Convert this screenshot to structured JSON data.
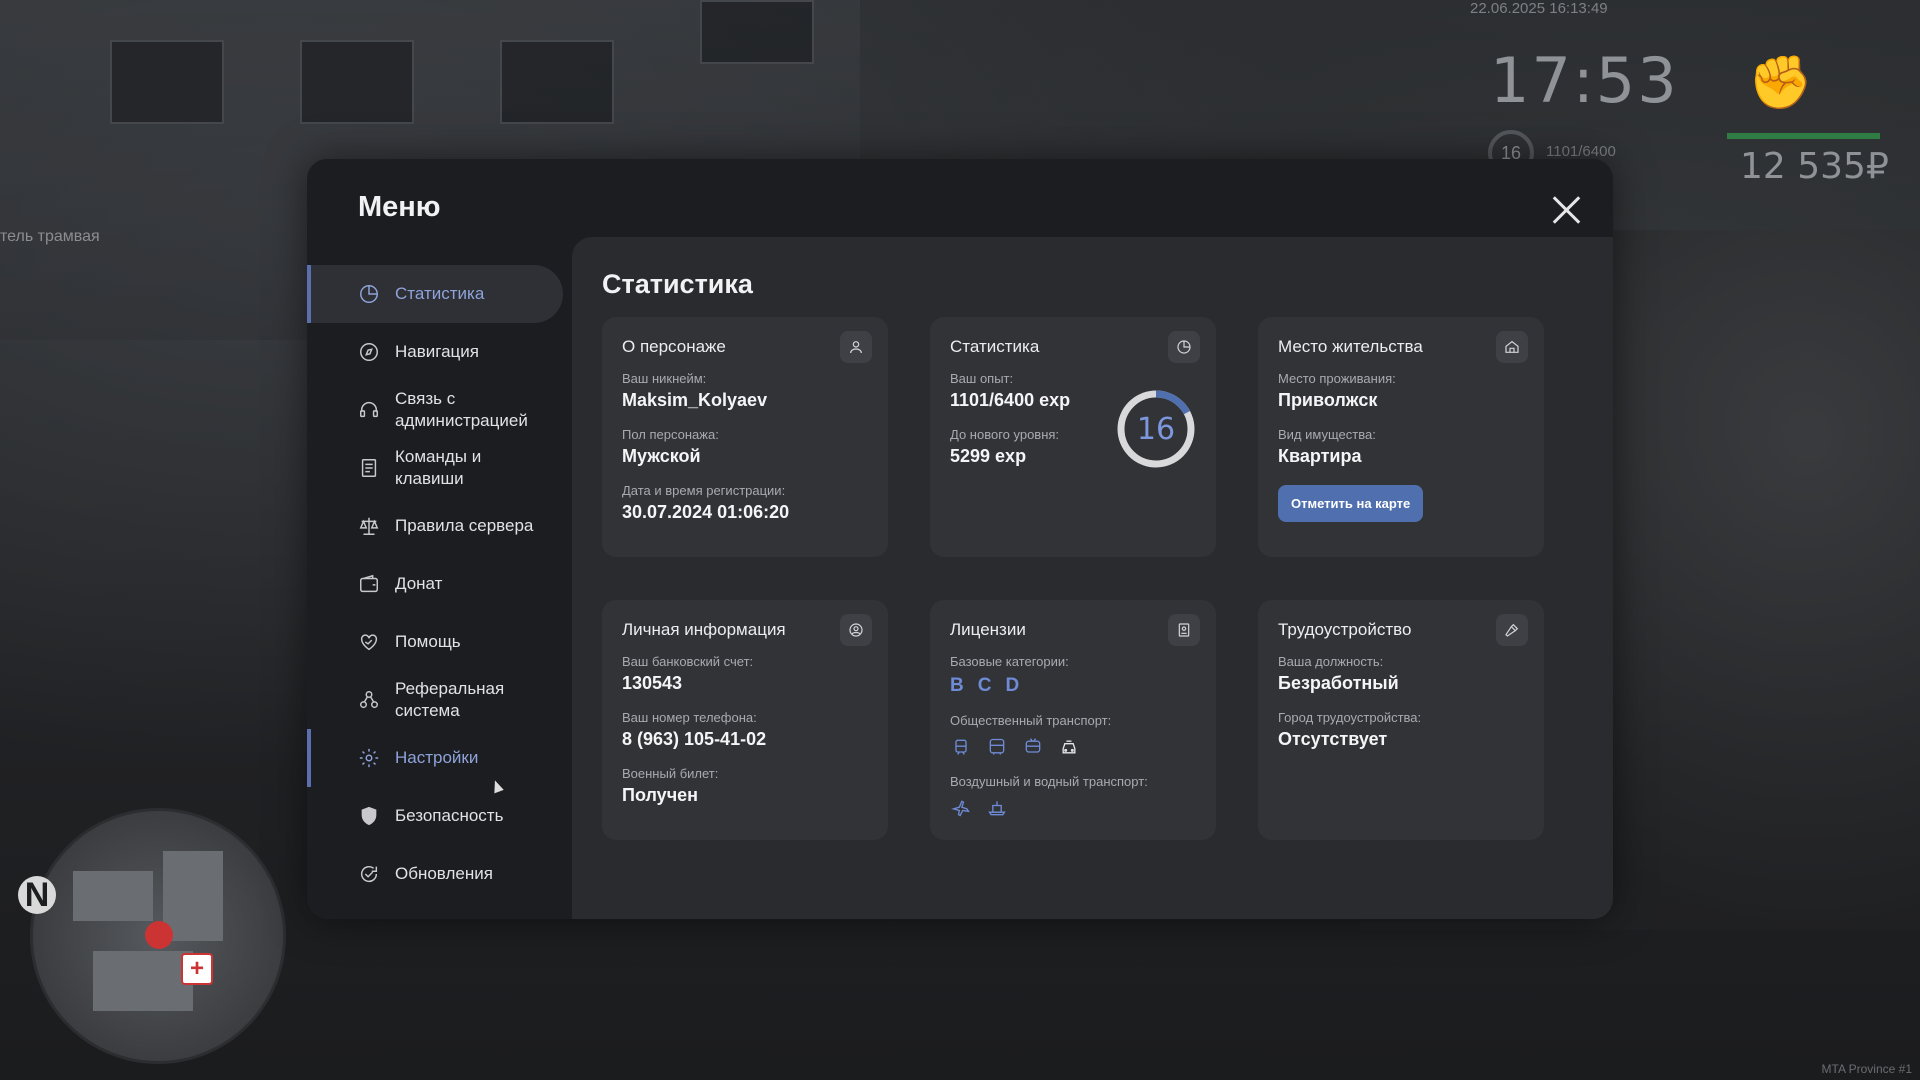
{
  "game": {
    "street_text": "тель трамвая",
    "datetime": "22.06.2025 16:13:49",
    "clock": "17:53",
    "level": "16",
    "exp": "1101/6400",
    "money": "12 535₽",
    "compass": "N",
    "watermark": "MTA Province #1"
  },
  "menu": {
    "title": "Меню",
    "close_icon": "close-icon"
  },
  "sidebar": {
    "items": [
      {
        "label": "Статистика",
        "icon": "pie-chart-icon"
      },
      {
        "label": "Навигация",
        "icon": "compass-icon"
      },
      {
        "label": "Связь с администрацией",
        "icon": "headset-icon"
      },
      {
        "label": "Команды и клавиши",
        "icon": "document-icon"
      },
      {
        "label": "Правила сервера",
        "icon": "scales-icon"
      },
      {
        "label": "Донат",
        "icon": "wallet-icon"
      },
      {
        "label": "Помощь",
        "icon": "heart-handshake-icon"
      },
      {
        "label": "Реферальная система",
        "icon": "referral-icon"
      },
      {
        "label": "Настройки",
        "icon": "gear-icon"
      },
      {
        "label": "Безопасность",
        "icon": "shield-icon"
      },
      {
        "label": "Обновления",
        "icon": "refresh-check-icon"
      }
    ]
  },
  "content": {
    "title": "Статистика",
    "character": {
      "title": "О персонаже",
      "nickname_label": "Ваш никнейм:",
      "nickname": "Maksim_Kolyaev",
      "gender_label": "Пол персонажа:",
      "gender": "Мужской",
      "reg_label": "Дата и время регистрации:",
      "reg": "30.07.2024 01:06:20"
    },
    "stats": {
      "title": "Статистика",
      "exp_label": "Ваш опыт:",
      "exp": "1101/6400 exp",
      "next_label": "До нового уровня:",
      "next": "5299 exp",
      "level": "16",
      "progress": 0.172
    },
    "residence": {
      "title": "Место жительства",
      "place_label": "Место проживания:",
      "place": "Приволжск",
      "type_label": "Вид имущества:",
      "type": "Квартира",
      "button": "Отметить на карте"
    },
    "personal": {
      "title": "Личная информация",
      "bank_label": "Ваш банковский счет:",
      "bank": "130543",
      "phone_label": "Ваш номер телефона:",
      "phone": "8 (963) 105-41-02",
      "military_label": "Военный билет:",
      "military": "Получен"
    },
    "licenses": {
      "title": "Лицензии",
      "basic_label": "Базовые категории:",
      "categories": [
        "B",
        "C",
        "D"
      ],
      "public_label": "Общественный транспорт:",
      "air_label": "Воздушный и водный транспорт:"
    },
    "job": {
      "title": "Трудоустройство",
      "position_label": "Ваша должность:",
      "position": "Безработный",
      "city_label": "Город трудоустройства:",
      "city": "Отсутствует"
    }
  },
  "colors": {
    "accent": "#8ea3d9",
    "button": "#4f6fae",
    "ring": "#7d97df"
  }
}
